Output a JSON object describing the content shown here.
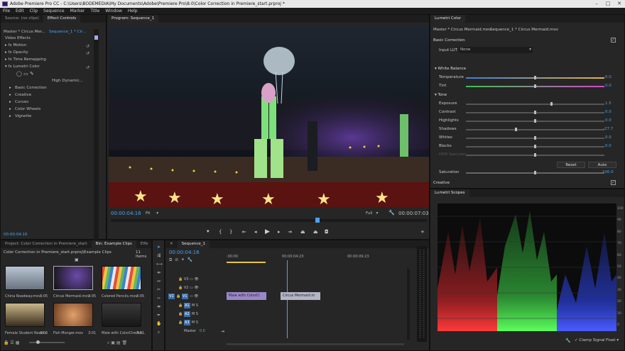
{
  "window": {
    "title": "Adobe Premiere Pro CC - C:\\Users\\BODEMEDIA\\My Documents\\Adobe\\Premiere Pro\\8.0\\Color Correction in Premiere_start.prproj *"
  },
  "menu": [
    "File",
    "Edit",
    "Clip",
    "Sequence",
    "Marker",
    "Title",
    "Window",
    "Help"
  ],
  "source_panel": {
    "tabs": [
      "Source: (no clips)",
      "Effect Controls"
    ],
    "master_label": "Master * Circus Mer...",
    "sequence_label": "Sequence_1 * Cir...",
    "video_effects": "Video Effects",
    "effects": [
      "Motion",
      "Opacity",
      "Time Remapping",
      "Lumetri Color"
    ],
    "high_dynamic": "High Dynamic...",
    "lumetri_sections": [
      "Basic Correction",
      "Creative",
      "Curves",
      "Color Wheels",
      "Vignette"
    ],
    "timecode": "00:00:04:16"
  },
  "program": {
    "tab": "Program: Sequence_1",
    "timecode": "00:00:04:16",
    "fit": "Fit",
    "quality": "Full",
    "duration": "00:00:07:03"
  },
  "lumetri": {
    "tab": "Lumetri Color",
    "master": "Master * Circus Mermaid.mov",
    "sequence": "Sequence_1 * Circus Mermaid.mov",
    "basic_correction": "Basic Correction",
    "input_lut_label": "Input LUT",
    "input_lut_value": "None",
    "white_balance": "White Balance",
    "tone": "Tone",
    "temperature": {
      "label": "Temperature",
      "value": "0.0",
      "pos": 0.5
    },
    "tint": {
      "label": "Tint",
      "value": "0.0",
      "pos": 0.5
    },
    "tone_rows": [
      {
        "label": "Exposure",
        "value": "1.5",
        "pos": 0.62
      },
      {
        "label": "Contrast",
        "value": "0.0",
        "pos": 0.5
      },
      {
        "label": "Highlights",
        "value": "0.0",
        "pos": 0.5
      },
      {
        "label": "Shadows",
        "value": "-27.7",
        "pos": 0.36
      },
      {
        "label": "Whites",
        "value": "0.0",
        "pos": 0.5
      },
      {
        "label": "Blacks",
        "value": "0.0",
        "pos": 0.5
      },
      {
        "label": "HDR Specular",
        "value": "",
        "pos": 0.5
      }
    ],
    "reset": "Reset",
    "auto": "Auto",
    "saturation": {
      "label": "Saturation",
      "value": "100.0",
      "pos": 0.5
    },
    "creative": "Creative"
  },
  "scopes": {
    "tab": "Lumetri Scopes",
    "scale": [
      "100",
      "90",
      "80",
      "70",
      "60",
      "50",
      "40",
      "30",
      "20",
      "10",
      "0"
    ],
    "clamp": "Clamp Signal",
    "float": "Float"
  },
  "project": {
    "tabs": [
      "Project: Color Correction in Premiere_start",
      "Bin: Example Clips",
      "Effe"
    ],
    "path": "Color Correction in Premiere_start.prproj\\Example Clips",
    "count": "11 Items",
    "clips": [
      {
        "name": "China Roadway.mov",
        "dur": "3:05"
      },
      {
        "name": "Circus Mermaid.mov",
        "dur": "3:05"
      },
      {
        "name": "Colored Pencils.mov",
        "dur": "3:05"
      },
      {
        "name": "Female Student Readi...",
        "dur": "3:06"
      },
      {
        "name": "Fish Monger.mov",
        "dur": "3:01"
      },
      {
        "name": "Male with ColorChecke...",
        "dur": "3:01"
      }
    ]
  },
  "timeline": {
    "tab": "Sequence_1",
    "timecode": "00:00:04:16",
    "ruler": [
      ":00:00",
      "00:00:04:23",
      "00:00:09:23"
    ],
    "video_tracks": [
      "V3",
      "V2",
      "V1"
    ],
    "audio_tracks": [
      "A1",
      "A2",
      "A3"
    ],
    "master": "Master",
    "master_val": "0.0",
    "clip_a": "Male with ColorCl",
    "clip_b": "Circus Mermaid.m"
  },
  "colors": {
    "accent": "#4aa3f0",
    "clip_purple": "#9b86c9",
    "clip_gray": "#b4b4c8"
  }
}
